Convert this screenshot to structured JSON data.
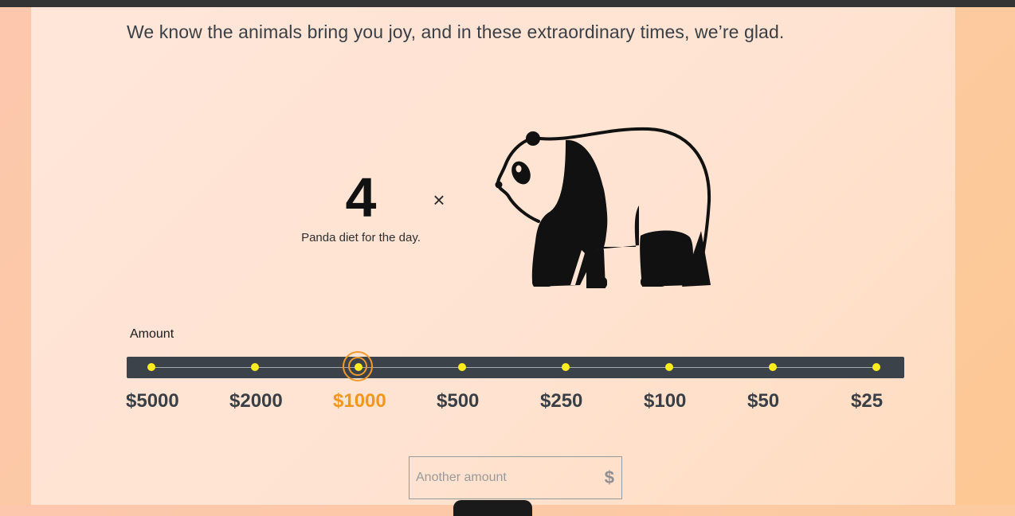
{
  "intro_text": "We know the animals bring you joy, and in these extraordinary times, we’re glad.",
  "impact": {
    "count": "4",
    "multiplier_symbol": "×",
    "unit_label": "Panda diet for the day.",
    "illustration_icon": "panda-icon"
  },
  "amount_selector": {
    "label": "Amount",
    "options": [
      "$5000",
      "$2000",
      "$1000",
      "$500",
      "$250",
      "$100",
      "$50",
      "$25"
    ],
    "selected": "$1000",
    "selected_index": 2,
    "accent_color": "#f3961e",
    "dot_color": "#ffec1f",
    "track_color": "#3c4249"
  },
  "other_amount": {
    "placeholder": "Another amount",
    "currency_symbol": "$"
  }
}
